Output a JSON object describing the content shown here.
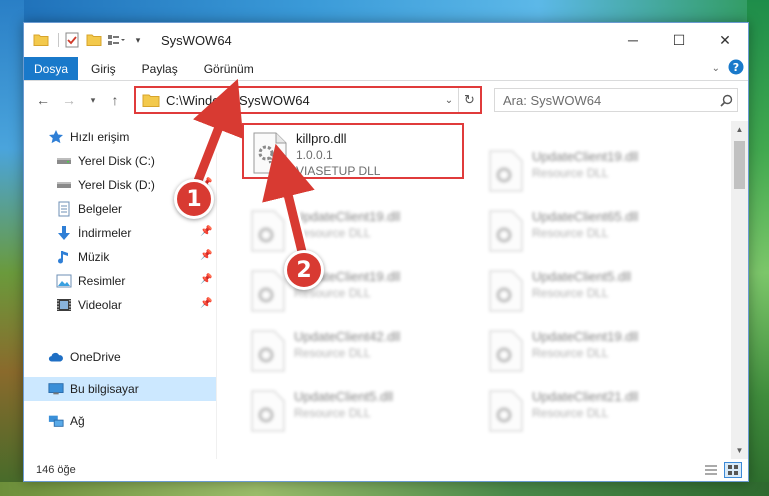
{
  "window": {
    "title": "SysWOW64"
  },
  "ribbon": {
    "tabs": [
      "Dosya",
      "Giriş",
      "Paylaş",
      "Görünüm"
    ]
  },
  "address": {
    "path": "C:\\Windows\\SysWOW64"
  },
  "search": {
    "placeholder": "Ara: SysWOW64"
  },
  "sidebar": {
    "items": [
      {
        "label": "Hızlı erişim",
        "icon": "star-icon",
        "pinned": false
      },
      {
        "label": "Yerel Disk (C:)",
        "icon": "drive-icon",
        "pinned": true
      },
      {
        "label": "Yerel Disk (D:)",
        "icon": "drive-icon",
        "pinned": true
      },
      {
        "label": "Belgeler",
        "icon": "document-icon",
        "pinned": true
      },
      {
        "label": "İndirmeler",
        "icon": "download-icon",
        "pinned": true
      },
      {
        "label": "Müzik",
        "icon": "music-icon",
        "pinned": true
      },
      {
        "label": "Resimler",
        "icon": "pictures-icon",
        "pinned": true
      },
      {
        "label": "Videolar",
        "icon": "video-icon",
        "pinned": true
      },
      {
        "label": "OneDrive",
        "icon": "cloud-icon",
        "pinned": false
      },
      {
        "label": "Bu bilgisayar",
        "icon": "computer-icon",
        "pinned": false
      },
      {
        "label": "Ağ",
        "icon": "network-icon",
        "pinned": false
      }
    ]
  },
  "files": [
    {
      "name": "killpro.dll",
      "line2": "1.0.0.1",
      "line3": "VIASETUP DLL"
    },
    {
      "name": "UpdateClient19.dll",
      "line2": "Resource DLL"
    },
    {
      "name": "UpdateClient19.dll",
      "line2": "Resource DLL"
    },
    {
      "name": "UpdateClient65.dll",
      "line2": "Resource DLL"
    },
    {
      "name": "UpdateClient19.dll",
      "line2": "Resource DLL"
    },
    {
      "name": "UpdateClient5.dll",
      "line2": "Resource DLL"
    },
    {
      "name": "UpdateClient42.dll",
      "line2": "Resource DLL"
    },
    {
      "name": "UpdateClient19.dll",
      "line2": "Resource DLL"
    },
    {
      "name": "UpdateClient5.dll",
      "line2": "Resource DLL"
    },
    {
      "name": "UpdateClient21.dll",
      "line2": "Resource DLL"
    }
  ],
  "status": {
    "count": "146 öğe"
  },
  "annotations": {
    "badge1": "1",
    "badge2": "2",
    "color": "#d83a32"
  }
}
